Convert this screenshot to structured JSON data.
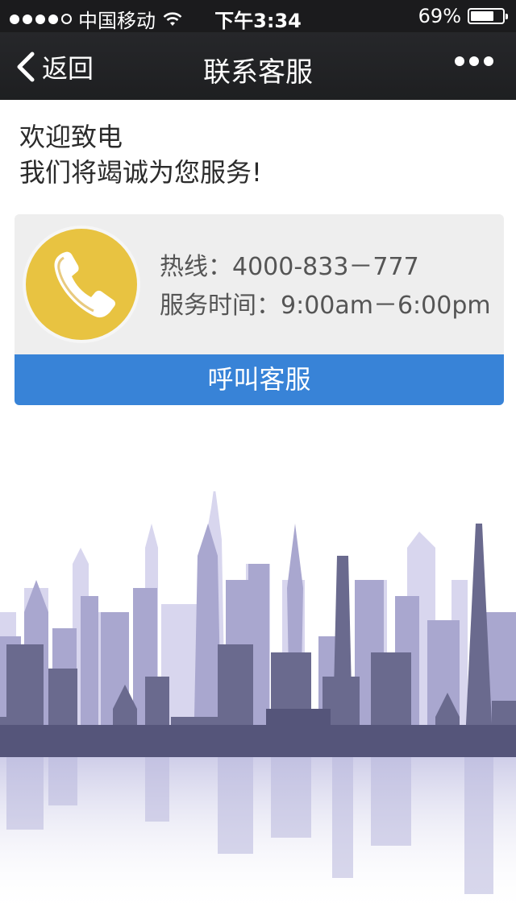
{
  "status_bar": {
    "carrier": "中国移动",
    "time": "下午3:34",
    "battery": "69%",
    "battery_level": 0.69,
    "signal_dots_filled": 4,
    "wifi_icon": "wifi-icon"
  },
  "nav": {
    "back_label": "返回",
    "title": "联系客服",
    "more_icon": "ellipsis-icon"
  },
  "welcome": {
    "line1": "欢迎致电",
    "line2": "我们将竭诚为您服务!"
  },
  "contact": {
    "phone_icon": "phone-icon",
    "hotline": "热线：4000-833－777",
    "hours": "服务时间：9:00am－6:00pm",
    "call_button": "呼叫客服"
  },
  "colors": {
    "nav_bg": "#1e1f21",
    "button_blue": "#3883d7",
    "icon_yellow": "#e8c341",
    "card_bg": "#eeeeee",
    "skyline_dark": "#5f5f85",
    "skyline_light": "#c7c5e3"
  }
}
